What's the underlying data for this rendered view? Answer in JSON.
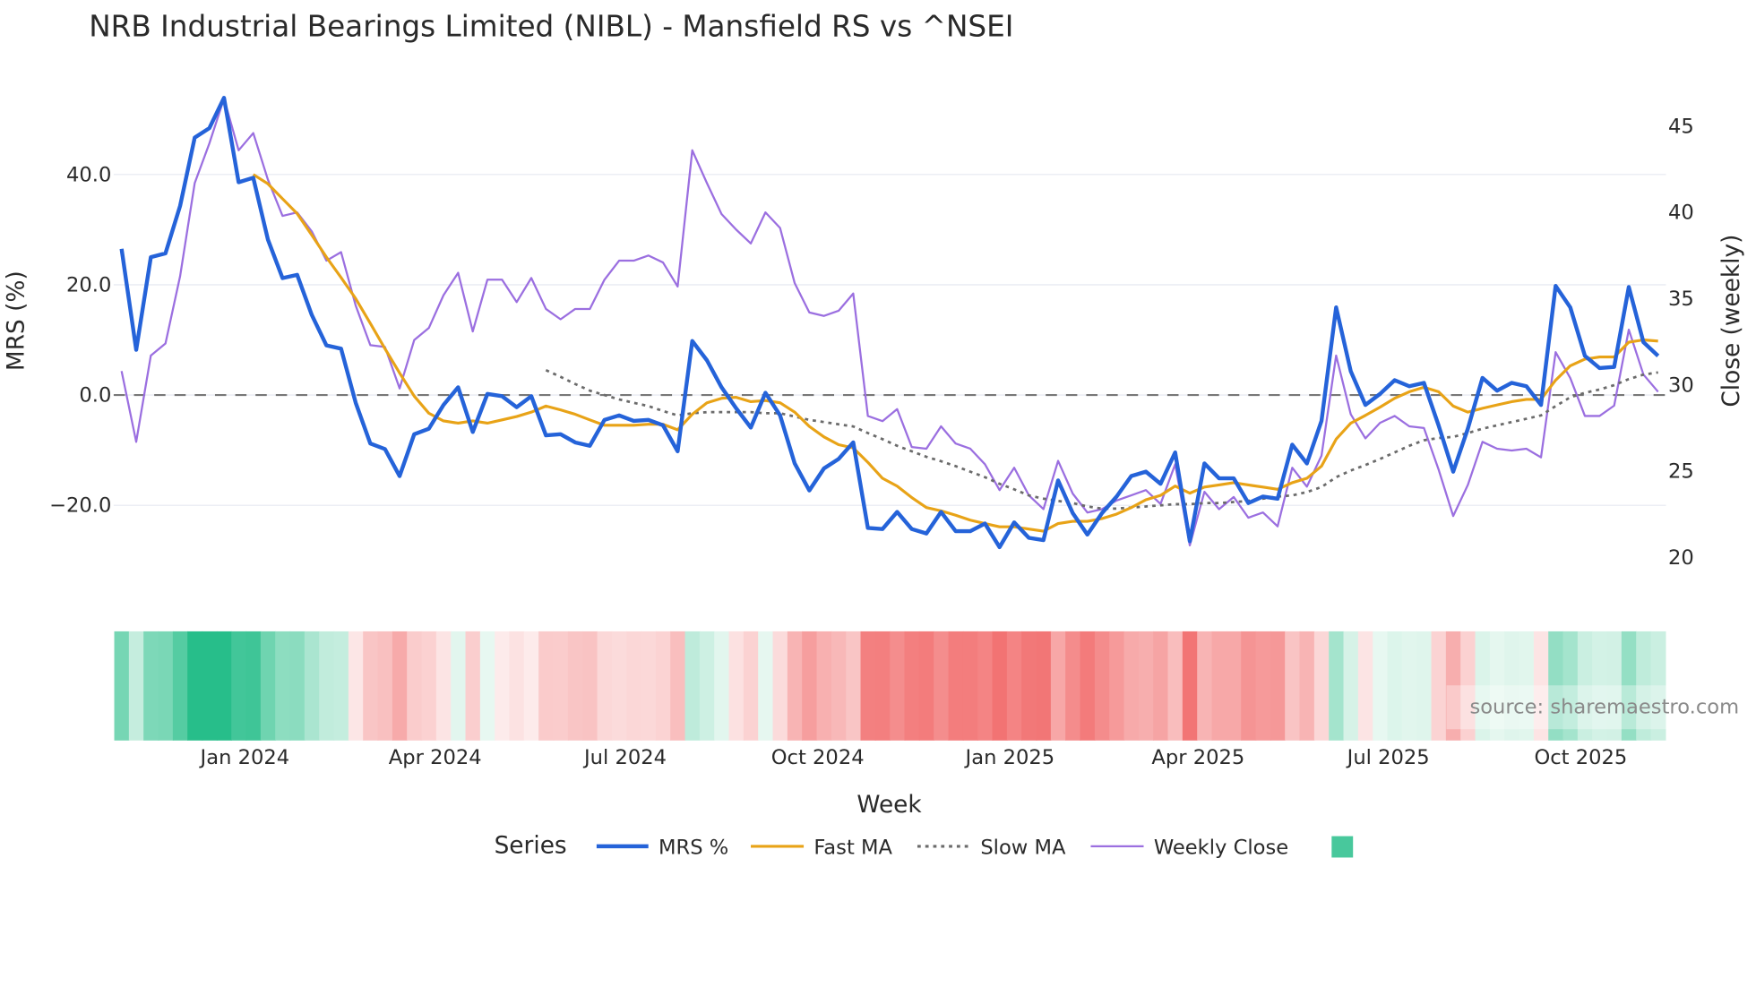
{
  "chart_data": {
    "type": "line",
    "title": "NRB Industrial Bearings Limited (NIBL) - Mansfield RS vs ^NSEI",
    "xlabel": "Week",
    "ylabel": "MRS (%)",
    "y2label": "Close (weekly)",
    "x_start_week": "2023-11-03",
    "x_interval_days": 7,
    "ylim": [
      -33,
      58
    ],
    "y2lim": [
      16.1,
      48
    ],
    "yticks": [
      {
        "v": 40,
        "label": "40.0"
      },
      {
        "v": 20,
        "label": "20.0"
      },
      {
        "v": 0,
        "label": "0.0"
      },
      {
        "v": -20,
        "label": "−20.0"
      }
    ],
    "y2ticks": [
      {
        "v": 45,
        "label": "45"
      },
      {
        "v": 40,
        "label": "40"
      },
      {
        "v": 35,
        "label": "35"
      },
      {
        "v": 30,
        "label": "30"
      },
      {
        "v": 25,
        "label": "25"
      },
      {
        "v": 20,
        "label": "20"
      }
    ],
    "xticks": [
      {
        "date": "2024-01-01",
        "label": "Jan 2024"
      },
      {
        "date": "2024-04-01",
        "label": "Apr 2024"
      },
      {
        "date": "2024-07-01",
        "label": "Jul 2024"
      },
      {
        "date": "2024-10-01",
        "label": "Oct 2024"
      },
      {
        "date": "2025-01-01",
        "label": "Jan 2025"
      },
      {
        "date": "2025-04-01",
        "label": "Apr 2025"
      },
      {
        "date": "2025-07-01",
        "label": "Jul 2025"
      },
      {
        "date": "2025-10-01",
        "label": "Oct 2025"
      }
    ],
    "zero_line": 0,
    "grid": true,
    "legend": {
      "title": "Series",
      "placement": "bottom-center"
    },
    "source": "source: sharemaestro.com",
    "series": [
      {
        "name": "MRS %",
        "axis": "left",
        "color": "#2563d9",
        "values": [
          26.5,
          8.2,
          25,
          25.7,
          34.3,
          46.7,
          48.4,
          53.9,
          38.6,
          39.4,
          28.2,
          21.2,
          21.8,
          14.5,
          9,
          8.4,
          -1.4,
          -8.8,
          -9.8,
          -14.7,
          -7.1,
          -6.1,
          -1.8,
          1.4,
          -6.7,
          0.2,
          -0.2,
          -2.2,
          -0.2,
          -7.3,
          -7.1,
          -8.6,
          -9.2,
          -4.5,
          -3.7,
          -4.7,
          -4.5,
          -5.5,
          -10.2,
          9.8,
          6.3,
          1.4,
          -2.4,
          -5.9,
          0.4,
          -3.7,
          -12.4,
          -17.3,
          -13.3,
          -11.6,
          -8.6,
          -24.1,
          -24.3,
          -21.2,
          -24.3,
          -25.1,
          -21.2,
          -24.7,
          -24.7,
          -23.3,
          -27.6,
          -23.1,
          -25.9,
          -26.3,
          -15.5,
          -21.4,
          -25.3,
          -21.4,
          -18.4,
          -14.7,
          -13.9,
          -16.1,
          -10.4,
          -26.5,
          -12.4,
          -15.1,
          -15.1,
          -19.6,
          -18.4,
          -18.8,
          -9,
          -12.4,
          -4.7,
          15.9,
          4.3,
          -1.8,
          0.2,
          2.7,
          1.6,
          2.2,
          -5.5,
          -13.9,
          -6.1,
          3.1,
          0.8,
          2.2,
          1.6,
          -1.8,
          19.8,
          15.9,
          7.1,
          4.9,
          5.1,
          19.6,
          9.6,
          7.1
        ]
      },
      {
        "name": "Fast MA",
        "axis": "left",
        "color": "#e8a317",
        "start_index": 9,
        "values": [
          40,
          38.3,
          35.6,
          32.9,
          29,
          25,
          21.3,
          17.5,
          13,
          8.4,
          4,
          -0.2,
          -3.3,
          -4.7,
          -5.1,
          -4.7,
          -5.1,
          -4.5,
          -3.9,
          -3.1,
          -2,
          -2.7,
          -3.5,
          -4.5,
          -5.5,
          -5.5,
          -5.5,
          -5.3,
          -5.3,
          -6.3,
          -3.5,
          -1.4,
          -0.6,
          -0.4,
          -1.2,
          -1,
          -1.4,
          -3.1,
          -5.7,
          -7.6,
          -9,
          -9.6,
          -12.2,
          -15.1,
          -16.5,
          -18.6,
          -20.4,
          -21,
          -21.8,
          -22.7,
          -23.3,
          -23.9,
          -23.9,
          -24.3,
          -24.7,
          -23.3,
          -22.9,
          -22.9,
          -22.4,
          -21.6,
          -20.4,
          -19,
          -18.2,
          -16.5,
          -17.8,
          -16.7,
          -16.3,
          -15.9,
          -16.3,
          -16.7,
          -17.1,
          -15.9,
          -15.1,
          -12.9,
          -8,
          -5.1,
          -3.7,
          -2.2,
          -0.6,
          0.6,
          1.4,
          0.6,
          -2,
          -3.1,
          -2.4,
          -1.8,
          -1.2,
          -0.8,
          -0.8,
          2.7,
          5.3,
          6.5,
          6.9,
          6.9,
          9.6,
          10,
          9.8
        ]
      },
      {
        "name": "Slow MA",
        "axis": "left",
        "color": "#6b6b6b",
        "start_index": 29,
        "values": [
          4.5,
          3.3,
          2,
          0.8,
          0,
          -0.8,
          -1.4,
          -2,
          -2.9,
          -3.7,
          -3.3,
          -3.1,
          -3.1,
          -3.1,
          -3.1,
          -3.3,
          -3.3,
          -3.9,
          -4.5,
          -4.9,
          -5.3,
          -5.7,
          -6.9,
          -8,
          -9.2,
          -10.2,
          -11.2,
          -12,
          -12.9,
          -13.9,
          -14.9,
          -16.1,
          -17.1,
          -18.2,
          -18.8,
          -19.2,
          -19.6,
          -20.2,
          -20.6,
          -20.6,
          -20.4,
          -20.2,
          -20,
          -19.8,
          -19.8,
          -19.6,
          -19.6,
          -19.4,
          -19.2,
          -18.8,
          -18.4,
          -18.2,
          -17.6,
          -16.7,
          -14.9,
          -13.7,
          -12.7,
          -11.6,
          -10.4,
          -9.2,
          -8.2,
          -7.8,
          -7.6,
          -6.9,
          -6.1,
          -5.5,
          -4.9,
          -4.3,
          -3.7,
          -2,
          -0.4,
          0.4,
          1,
          1.8,
          2.9,
          3.7,
          4.1
        ]
      },
      {
        "name": "Weekly Close",
        "axis": "right",
        "color": "#9b6fe0",
        "values": [
          30.8,
          26.7,
          31.7,
          32.4,
          36.3,
          41.7,
          44,
          46.6,
          43.6,
          44.6,
          41.9,
          39.8,
          40,
          38.9,
          37.2,
          37.7,
          34.6,
          32.3,
          32.2,
          29.8,
          32.6,
          33.3,
          35.2,
          36.5,
          33.1,
          36.1,
          36.1,
          34.8,
          36.2,
          34.4,
          33.8,
          34.4,
          34.4,
          36.1,
          37.2,
          37.2,
          37.5,
          37.1,
          35.7,
          43.6,
          41.7,
          39.9,
          39,
          38.2,
          40,
          39.1,
          35.9,
          34.2,
          34,
          34.3,
          35.3,
          28.2,
          27.9,
          28.6,
          26.4,
          26.3,
          27.6,
          26.6,
          26.3,
          25.4,
          23.9,
          25.2,
          23.6,
          22.8,
          25.6,
          23.7,
          22.6,
          22.8,
          23.3,
          23.6,
          23.9,
          23.1,
          25.4,
          20.7,
          23.8,
          22.8,
          23.5,
          22.3,
          22.6,
          21.8,
          25.2,
          24.1,
          25.9,
          31.7,
          28.3,
          26.9,
          27.8,
          28.2,
          27.6,
          27.5,
          25.1,
          22.4,
          24.2,
          26.7,
          26.3,
          26.2,
          26.3,
          25.8,
          31.9,
          30.4,
          28.2,
          28.2,
          28.8,
          33.2,
          30.6,
          29.6
        ]
      }
    ],
    "heatmap": {
      "source_series": "MRS %",
      "legend_color": "#48c89c",
      "positive_color": "#27be8a",
      "negative_color": "#f27373"
    }
  }
}
